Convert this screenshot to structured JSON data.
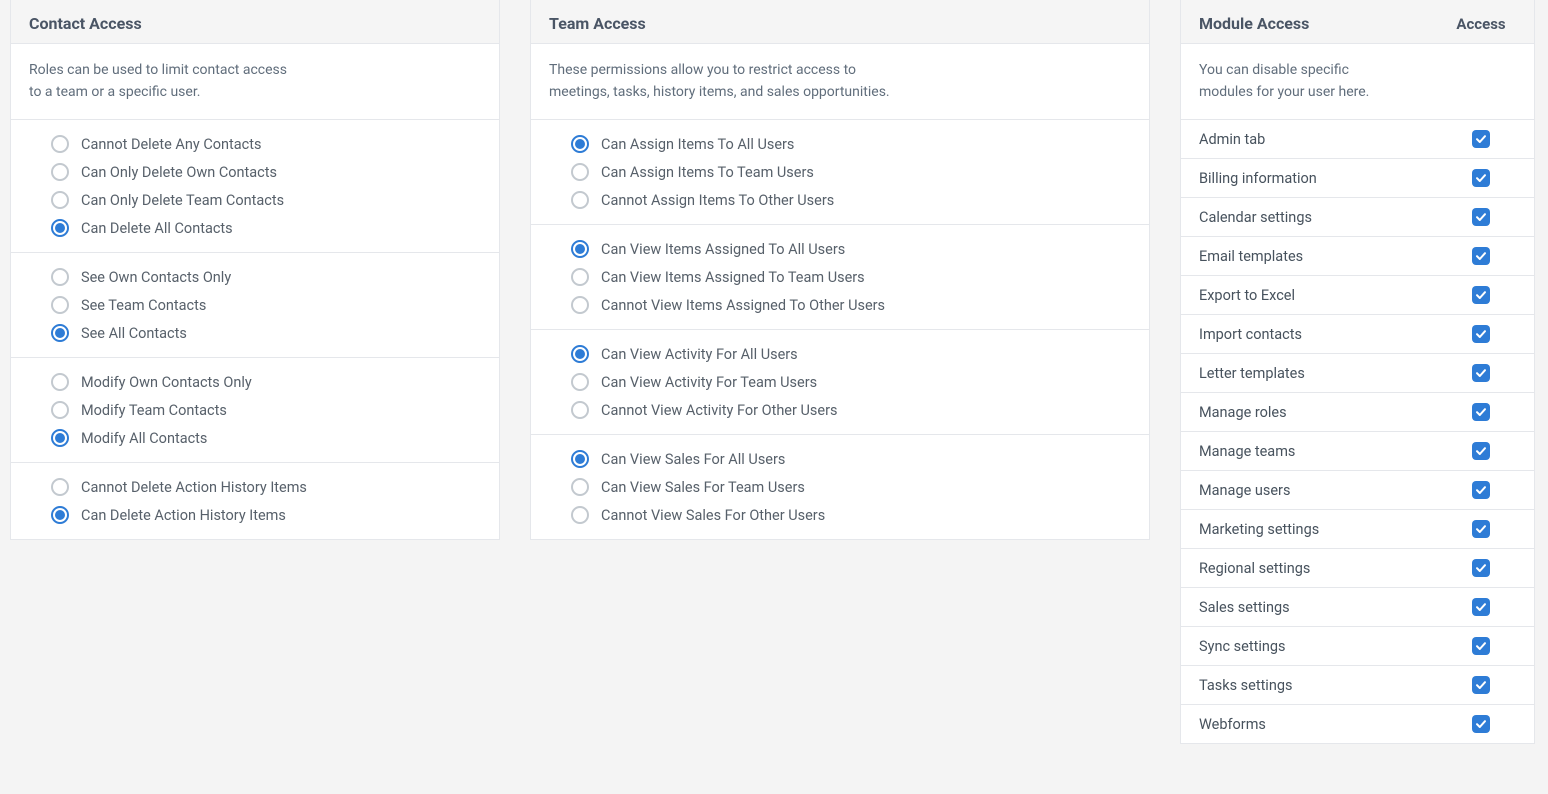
{
  "contact": {
    "title": "Contact Access",
    "desc_line1": "Roles can be used to limit contact access",
    "desc_line2": "to a team or a specific user.",
    "groups": [
      {
        "options": [
          {
            "label": "Cannot Delete Any Contacts",
            "selected": false
          },
          {
            "label": "Can Only Delete Own Contacts",
            "selected": false
          },
          {
            "label": "Can Only Delete Team Contacts",
            "selected": false
          },
          {
            "label": "Can Delete All Contacts",
            "selected": true
          }
        ]
      },
      {
        "options": [
          {
            "label": "See Own Contacts Only",
            "selected": false
          },
          {
            "label": "See Team Contacts",
            "selected": false
          },
          {
            "label": "See All Contacts",
            "selected": true
          }
        ]
      },
      {
        "options": [
          {
            "label": "Modify Own Contacts Only",
            "selected": false
          },
          {
            "label": "Modify Team Contacts",
            "selected": false
          },
          {
            "label": "Modify All Contacts",
            "selected": true
          }
        ]
      },
      {
        "options": [
          {
            "label": "Cannot Delete Action History Items",
            "selected": false
          },
          {
            "label": "Can Delete Action History Items",
            "selected": true
          }
        ]
      }
    ]
  },
  "team": {
    "title": "Team Access",
    "desc_line1": "These permissions allow you to restrict access to",
    "desc_line2": "meetings, tasks, history items, and sales opportunities.",
    "groups": [
      {
        "options": [
          {
            "label": "Can Assign Items To All Users",
            "selected": true
          },
          {
            "label": "Can Assign Items To Team Users",
            "selected": false
          },
          {
            "label": "Cannot Assign Items To Other Users",
            "selected": false
          }
        ]
      },
      {
        "options": [
          {
            "label": "Can View Items Assigned To All Users",
            "selected": true
          },
          {
            "label": "Can View Items Assigned To Team Users",
            "selected": false
          },
          {
            "label": "Cannot View Items Assigned To Other Users",
            "selected": false
          }
        ]
      },
      {
        "options": [
          {
            "label": "Can View Activity For All Users",
            "selected": true
          },
          {
            "label": "Can View Activity For Team Users",
            "selected": false
          },
          {
            "label": "Cannot View Activity For Other Users",
            "selected": false
          }
        ]
      },
      {
        "options": [
          {
            "label": "Can View Sales For All Users",
            "selected": true
          },
          {
            "label": "Can View Sales For Team Users",
            "selected": false
          },
          {
            "label": "Cannot View Sales For Other Users",
            "selected": false
          }
        ]
      }
    ]
  },
  "module": {
    "title": "Module Access",
    "access_header": "Access",
    "desc_line1": "You can disable specific",
    "desc_line2": "modules for your user here.",
    "items": [
      {
        "label": "Admin tab",
        "checked": true
      },
      {
        "label": "Billing information",
        "checked": true
      },
      {
        "label": "Calendar settings",
        "checked": true
      },
      {
        "label": "Email templates",
        "checked": true
      },
      {
        "label": "Export to Excel",
        "checked": true
      },
      {
        "label": "Import contacts",
        "checked": true
      },
      {
        "label": "Letter templates",
        "checked": true
      },
      {
        "label": "Manage roles",
        "checked": true
      },
      {
        "label": "Manage teams",
        "checked": true
      },
      {
        "label": "Manage users",
        "checked": true
      },
      {
        "label": "Marketing settings",
        "checked": true
      },
      {
        "label": "Regional settings",
        "checked": true
      },
      {
        "label": "Sales settings",
        "checked": true
      },
      {
        "label": "Sync settings",
        "checked": true
      },
      {
        "label": "Tasks settings",
        "checked": true
      },
      {
        "label": "Webforms",
        "checked": true
      }
    ]
  }
}
